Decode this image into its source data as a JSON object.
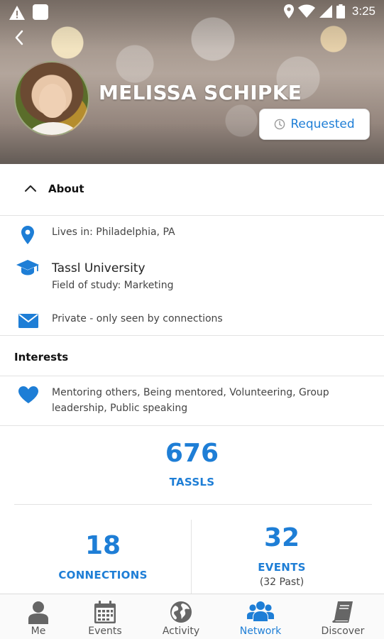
{
  "status_bar": {
    "time": "3:25"
  },
  "profile": {
    "name": "MELISSA SCHIPKE",
    "connection_button": "Requested"
  },
  "about": {
    "title": "About",
    "location": "Lives in: Philadelphia, PA",
    "school": "Tassl University",
    "field_of_study": "Field of study: Marketing",
    "email_privacy": "Private - only seen by connections"
  },
  "interests": {
    "title": "Interests",
    "text": "Mentoring others, Being mentored, Volunteering, Group leadership, Public speaking"
  },
  "stats": {
    "tassls": {
      "value": "676",
      "label": "TASSLS"
    },
    "connections": {
      "value": "18",
      "label": "CONNECTIONS"
    },
    "events": {
      "value": "32",
      "label": "EVENTS",
      "sub": "(32 Past)"
    }
  },
  "nav": {
    "items": [
      {
        "label": "Me",
        "icon": "person-icon"
      },
      {
        "label": "Events",
        "icon": "calendar-icon"
      },
      {
        "label": "Activity",
        "icon": "globe-icon"
      },
      {
        "label": "Network",
        "icon": "people-icon",
        "active": true
      },
      {
        "label": "Discover",
        "icon": "book-icon"
      }
    ]
  },
  "colors": {
    "accent": "#1e7ed6",
    "text": "#444444",
    "divider": "#e3e3e3"
  }
}
